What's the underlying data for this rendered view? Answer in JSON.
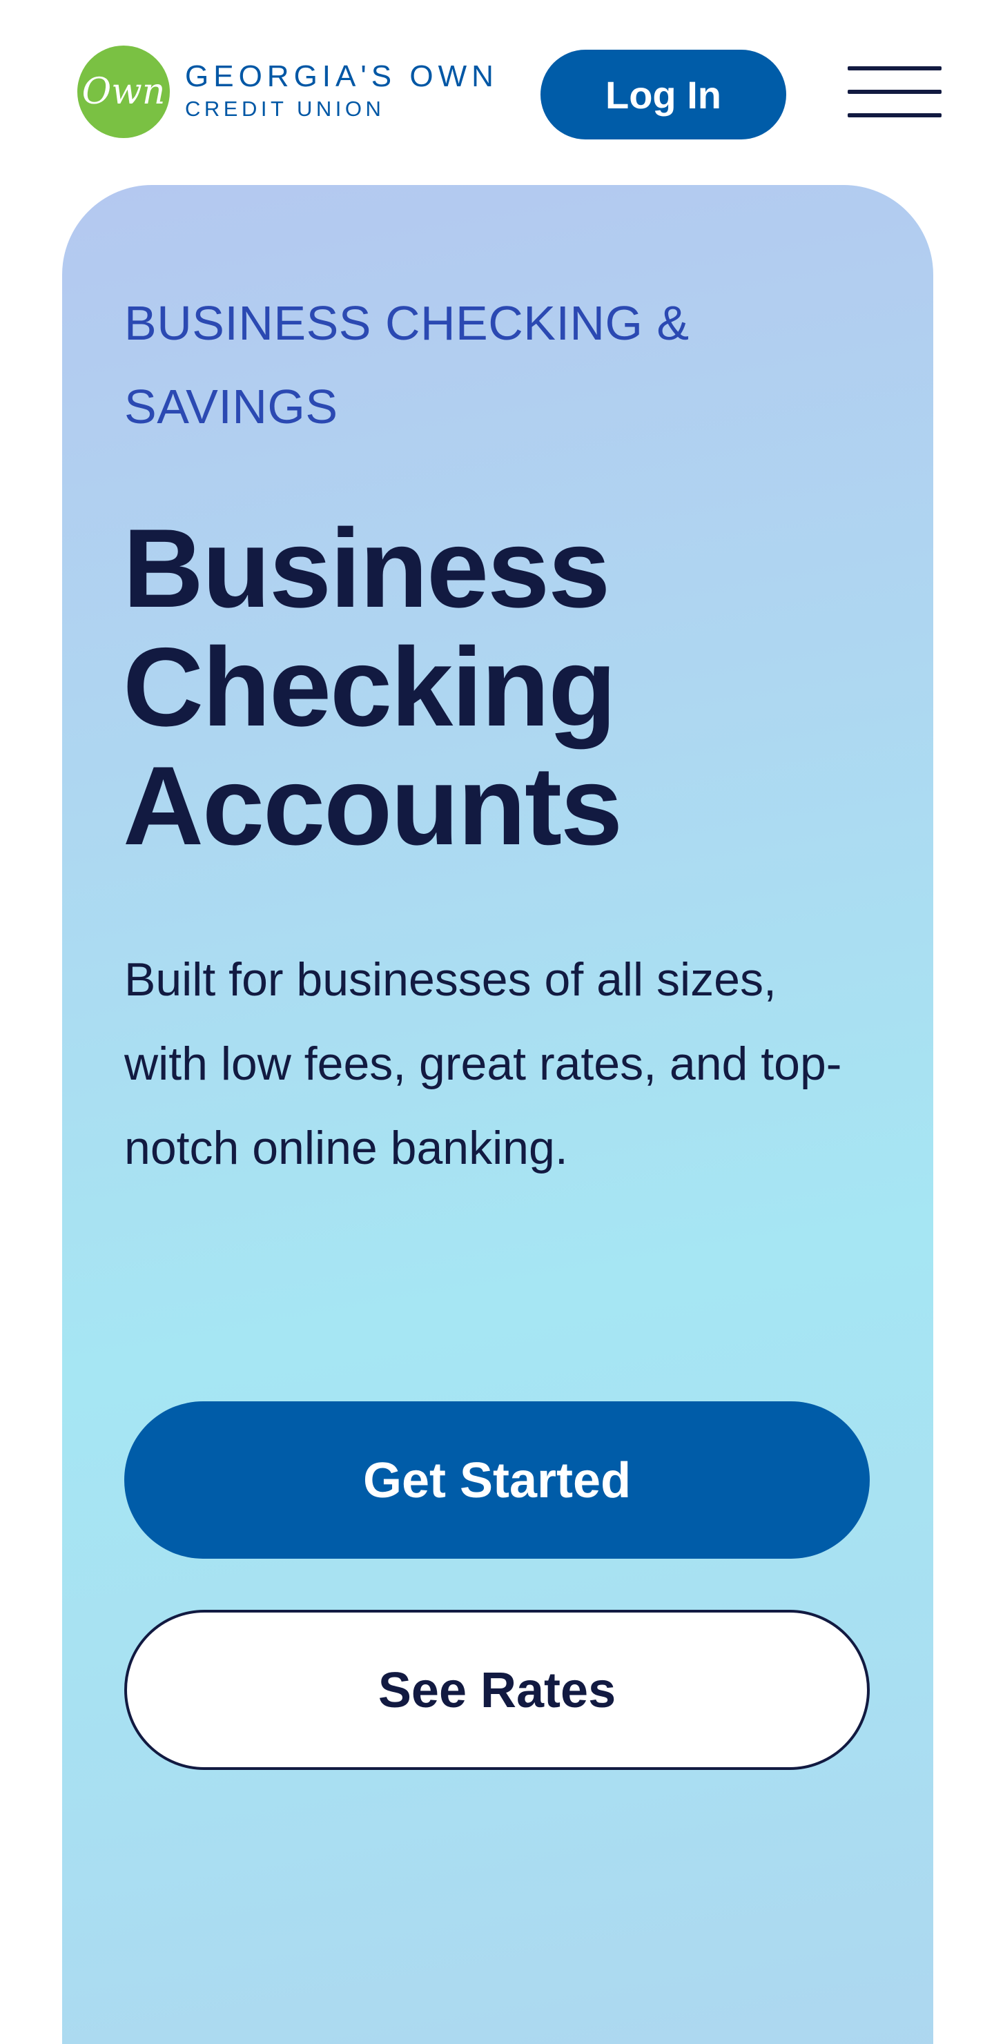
{
  "brand": {
    "badge_text": "Own",
    "name_line1": "GEORGIA'S OWN",
    "name_line2": "CREDIT UNION",
    "badge_color": "#7ac143",
    "text_color": "#0057a5"
  },
  "header": {
    "login_label": "Log In",
    "menu_icon": "hamburger-menu-icon",
    "login_color": "#005ca8"
  },
  "hero": {
    "eyebrow_line1": "BUSINESS CHECKING &",
    "eyebrow_line2": "SAVINGS",
    "headline_line1": "Business",
    "headline_line2": "Checking",
    "headline_line3": "Accounts",
    "description": "Built for businesses of all sizes, with low fees, great rates, and top-notch online banking.",
    "primary_cta": "Get Started",
    "secondary_cta": "See Rates",
    "eyebrow_color": "#2b49b2",
    "text_color": "#121a41",
    "primary_color": "#005ca8"
  }
}
